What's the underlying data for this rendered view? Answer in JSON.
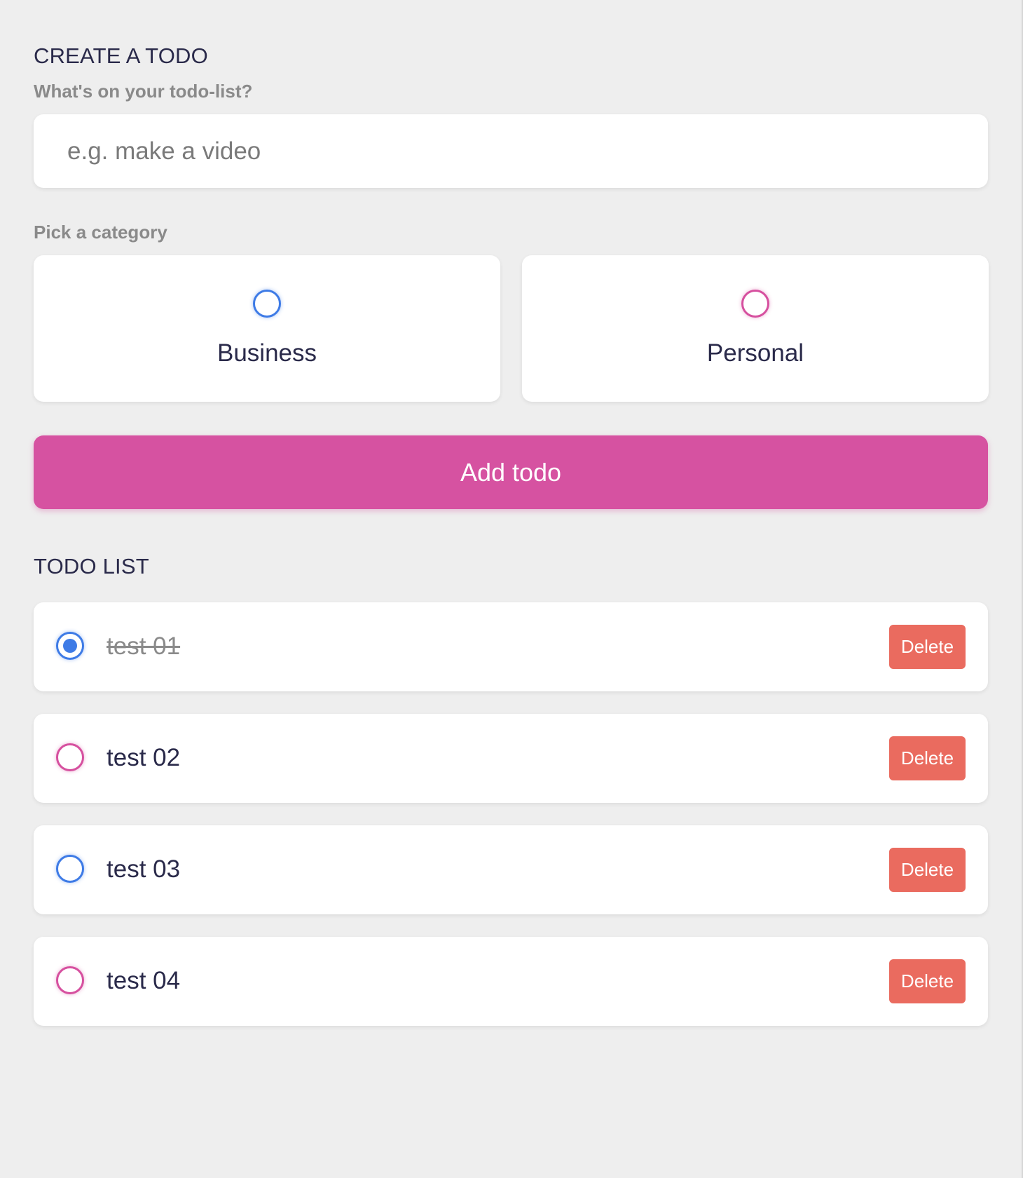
{
  "create_section": {
    "title": "CREATE A TODO",
    "input_label": "What's on your todo-list?",
    "input_placeholder": "e.g. make a video",
    "input_value": "",
    "category_label": "Pick a category",
    "categories": [
      {
        "label": "Business",
        "color": "#3e7be6",
        "selected": false
      },
      {
        "label": "Personal",
        "color": "#d6509f",
        "selected": false
      }
    ],
    "add_button_label": "Add todo"
  },
  "list_section": {
    "title": "TODO LIST",
    "todos": [
      {
        "text": "test 01",
        "category": "Business",
        "done": true,
        "delete_label": "Delete"
      },
      {
        "text": "test 02",
        "category": "Personal",
        "done": false,
        "delete_label": "Delete"
      },
      {
        "text": "test 03",
        "category": "Business",
        "done": false,
        "delete_label": "Delete"
      },
      {
        "text": "test 04",
        "category": "Personal",
        "done": false,
        "delete_label": "Delete"
      }
    ]
  },
  "colors": {
    "background": "#eeeeee",
    "accent": "#d652a1",
    "business": "#3e7be6",
    "personal": "#d6509f",
    "delete": "#ea6b5f",
    "text": "#2a2a4a",
    "muted": "#8a8a8a"
  }
}
